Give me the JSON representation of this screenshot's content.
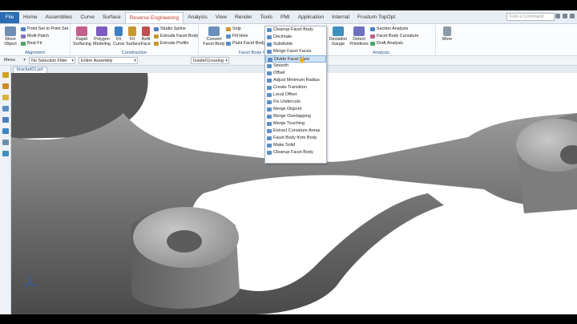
{
  "tabs": [
    "File",
    "Home",
    "Assemblies",
    "Curve",
    "Surface",
    "Reverse Engineering",
    "Analysis",
    "View",
    "Render",
    "Tools",
    "PMI",
    "Application",
    "Internal",
    "Frustum TopOpt"
  ],
  "find_command_placeholder": "Find a Command",
  "ribbon": {
    "move_object": "Move Object",
    "point_set": "Point Set to Point Set",
    "multi_patch": "Multi-Patch",
    "best_fit": "Best Fit",
    "alignment_label": "Alignment",
    "rapid_surfacing": "Rapid Surfacing",
    "polygon_modeling": "Polygon Modeling",
    "fit_curve": "Fit Curve",
    "fit_surface": "Fit Surface",
    "refit_face": "Refit Face",
    "studio_spline": "Studio Spline",
    "extrude_facet_body": "Extrude Facet Body",
    "extrude_profile": "Extrude Profile",
    "construction_label": "Construction",
    "convert_facet_body": "Convert Facet Body",
    "snip": "Snip",
    "fill_hole": "Fill Hole",
    "paint_facet_body": "Paint Facet Body",
    "facet_body_ops_label": "Facet Body Op",
    "deviation_gauge": "Deviation Gauge",
    "detect_primitives": "Detect Primitives",
    "section_analysis": "Section Analysis",
    "facet_body_curvature": "Facet Body Curvature",
    "draft_analysis": "Draft Analysis",
    "analysis_label": "Analysis",
    "more": "More"
  },
  "selbar": {
    "menu": "Menu",
    "filter": "No Selection Filter",
    "scope": "Entire Assembly",
    "mode": "Inside/Crossing"
  },
  "file_tab": "bracket01.prt",
  "dropdown_items": [
    "Cleanup Facet Body",
    "Decimate",
    "Subdivide",
    "Merge Facet Faces",
    "Divide Facet Face",
    "Smooth",
    "Offset",
    "Adjust Minimum Radius",
    "Create Transition",
    "Local Offset",
    "Fix Undercuts",
    "Merge Disjoint",
    "Merge Overlapping",
    "Merge Touching",
    "Extract Curvature Areas",
    "Facet Body from Body",
    "Make Solid",
    "Cleanup Facet Body"
  ],
  "highlighted_index": 4,
  "colors": {
    "accent": "#2b6cb3",
    "active_tab_text": "#c0392b",
    "group_label": "#2a5a92",
    "highlight": "#cfe3f6"
  }
}
